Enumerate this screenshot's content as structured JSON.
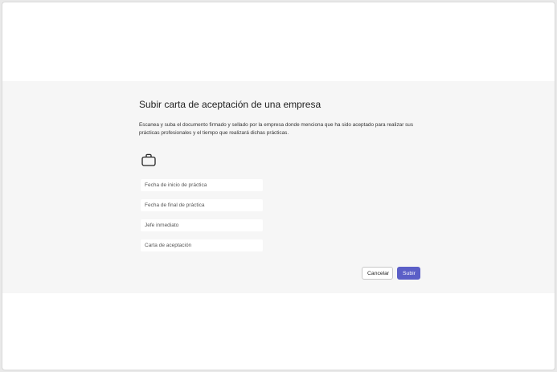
{
  "dialog": {
    "title": "Subir carta de aceptación de una empresa",
    "description": "Escanea y suba el documento firmado y sellado por la empresa donde menciona que ha sido aceptado para realizar sus prácticas profesionales y el tiempo que realizará dichas prácticas.",
    "icon": "briefcase-icon",
    "fields": [
      {
        "placeholder": "Fecha de inicio de práctica"
      },
      {
        "placeholder": "Fecha de final de práctica"
      },
      {
        "placeholder": "Jefe inmediato"
      },
      {
        "placeholder": "Carta de aceptación"
      }
    ],
    "buttons": {
      "cancel": "Cancelar",
      "submit": "Subir"
    }
  },
  "colors": {
    "accent": "#5b5fc7",
    "band_background": "#f6f6f6",
    "field_background": "#ffffff"
  }
}
